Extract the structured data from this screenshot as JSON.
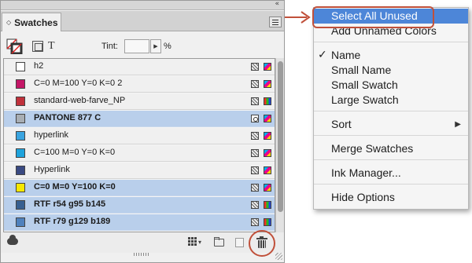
{
  "panel": {
    "tab_label": "Swatches",
    "tab_icon": "double-chevron-icon",
    "collapse_glyph": "«",
    "tint_label": "Tint:",
    "tint_value": "",
    "tint_unit": "%"
  },
  "swatches": [
    {
      "name": "h2",
      "color": "#ffffff",
      "bold": false,
      "selected": false,
      "type": "process",
      "mode": "cmyk"
    },
    {
      "name": "C=0 M=100 Y=0 K=0 2",
      "color": "#c41767",
      "bold": false,
      "selected": false,
      "type": "process",
      "mode": "cmyk"
    },
    {
      "name": "standard-web-farve_NP",
      "color": "#c0313b",
      "bold": false,
      "selected": false,
      "type": "process",
      "mode": "rgb"
    },
    {
      "name": "PANTONE 877 C",
      "color": "#a8aeb4",
      "bold": true,
      "selected": true,
      "type": "spot",
      "mode": "cmyk"
    },
    {
      "name": "hyperlink",
      "color": "#3aa4e0",
      "bold": false,
      "selected": false,
      "type": "process",
      "mode": "cmyk"
    },
    {
      "name": "C=100 M=0 Y=0 K=0",
      "color": "#1ea3dc",
      "bold": false,
      "selected": false,
      "type": "process",
      "mode": "cmyk"
    },
    {
      "name": "Hyperlink",
      "color": "#3a4a82",
      "bold": false,
      "selected": false,
      "type": "process",
      "mode": "cmyk"
    },
    {
      "name": "C=0 M=0 Y=100 K=0",
      "color": "#f7e800",
      "bold": true,
      "selected": true,
      "type": "process",
      "mode": "cmyk"
    },
    {
      "name": "RTF r54 g95 b145",
      "color": "#365f91",
      "bold": true,
      "selected": true,
      "type": "process",
      "mode": "rgb"
    },
    {
      "name": "RTF r79 g129 b189",
      "color": "#4f81bd",
      "bold": true,
      "selected": true,
      "type": "process",
      "mode": "rgb"
    }
  ],
  "menu": {
    "items": [
      {
        "label": "Select All Unused",
        "highlighted": true,
        "checked": false,
        "submenu": false
      },
      {
        "label": "Add Unnamed Colors",
        "highlighted": false,
        "checked": false,
        "submenu": false
      },
      {
        "separator": true
      },
      {
        "label": "Name",
        "highlighted": false,
        "checked": true,
        "submenu": false
      },
      {
        "label": "Small Name",
        "highlighted": false,
        "checked": false,
        "submenu": false
      },
      {
        "label": "Small Swatch",
        "highlighted": false,
        "checked": false,
        "submenu": false
      },
      {
        "label": "Large Swatch",
        "highlighted": false,
        "checked": false,
        "submenu": false
      },
      {
        "separator": true
      },
      {
        "label": "Sort",
        "highlighted": false,
        "checked": false,
        "submenu": true
      },
      {
        "separator": true
      },
      {
        "label": "Merge Swatches",
        "highlighted": false,
        "checked": false,
        "submenu": false
      },
      {
        "separator": true
      },
      {
        "label": "Ink Manager...",
        "highlighted": false,
        "checked": false,
        "submenu": false
      },
      {
        "separator": true
      },
      {
        "label": "Hide Options",
        "highlighted": false,
        "checked": false,
        "submenu": false
      }
    ]
  },
  "colors": {
    "callout": "#c0503a",
    "menu_highlight": "#4d86d8",
    "row_selected": "#b9cfeb"
  }
}
